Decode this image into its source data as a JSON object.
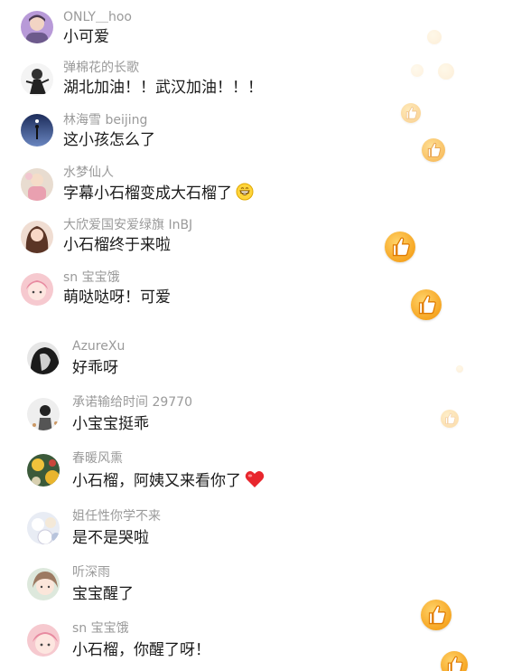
{
  "comments": [
    {
      "username": "ONLY＿hoo",
      "text": "小可爱"
    },
    {
      "username": "弹棉花的长歌",
      "text": "湖北加油！！武汉加油！！！"
    },
    {
      "username": "林海雪 beijing",
      "text": "这小孩怎么了"
    },
    {
      "username": "水梦仙人",
      "text": "字幕小石榴变成大石榴了",
      "emoji": "grin-emoji"
    },
    {
      "username": "大欣爱国安爱绿旗 InBJ",
      "text": "小石榴终于来啦"
    },
    {
      "username": "sn 宝宝饿",
      "text": "萌哒哒呀！可爱"
    },
    {
      "username": "AzureXu",
      "text": "好乖呀"
    },
    {
      "username": "承诺输给时间 29770",
      "text": "小宝宝挺乖"
    },
    {
      "username": "春暖风熏",
      "text": "小石榴，阿姨又来看你了",
      "emoji": "red-heart-emoji"
    },
    {
      "username": "姐任性你学不来",
      "text": "是不是哭啦"
    },
    {
      "username": "听深雨",
      "text": "宝宝醒了"
    },
    {
      "username": "sn 宝宝饿",
      "text": "小石榴，你醒了呀！"
    }
  ],
  "colors": {
    "username": "#9a9a9a",
    "text": "#1a1a1a",
    "like_bubble": "#f6a623",
    "heart": "#e8262d"
  },
  "icons": [
    "thumbs-up-icon",
    "grin-emoji",
    "red-heart-emoji"
  ]
}
